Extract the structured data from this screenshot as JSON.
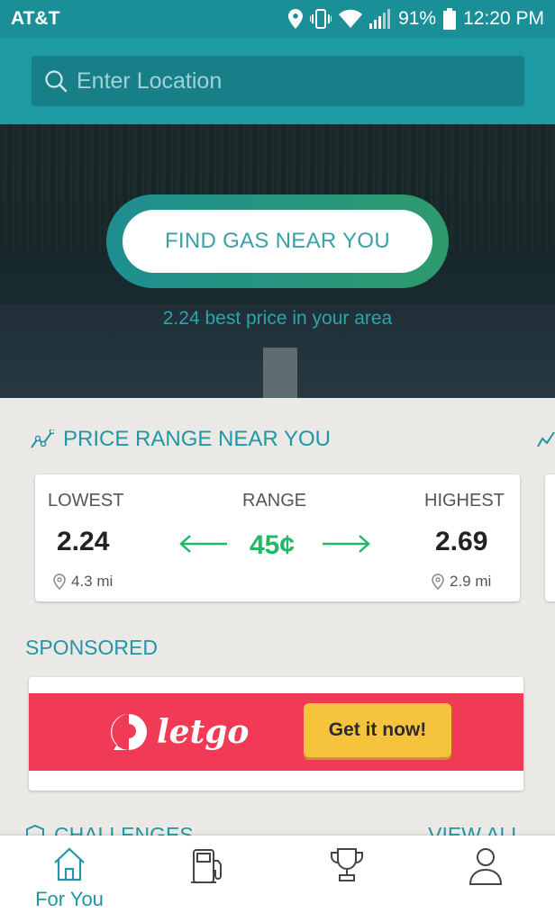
{
  "status_bar": {
    "carrier": "AT&T",
    "battery": "91%",
    "time": "12:20 PM"
  },
  "search": {
    "placeholder": "Enter Location"
  },
  "hero": {
    "cta_label": "FIND GAS NEAR YOU",
    "best_price_text": "2.24 best price in your area"
  },
  "price_range": {
    "title": "PRICE RANGE NEAR YOU",
    "lowest": {
      "label": "LOWEST",
      "value": "2.24",
      "distance": "4.3 mi"
    },
    "range": {
      "label": "RANGE",
      "value": "45¢"
    },
    "highest": {
      "label": "HIGHEST",
      "value": "2.69",
      "distance": "2.9 mi"
    }
  },
  "sponsored": {
    "title": "SPONSORED",
    "ad": {
      "brand": "letgo",
      "cta": "Get it now!",
      "background_color": "#f03a56",
      "cta_color": "#f6c33d"
    }
  },
  "challenges": {
    "title": "CHALLENGES",
    "view_all": "VIEW ALL"
  },
  "bottom_nav": {
    "items": [
      {
        "icon": "home-icon",
        "label": "For You",
        "active": true
      },
      {
        "icon": "gas-pump-icon",
        "label": "",
        "active": false
      },
      {
        "icon": "trophy-icon",
        "label": "",
        "active": false
      },
      {
        "icon": "profile-icon",
        "label": "",
        "active": false
      }
    ]
  },
  "colors": {
    "accent": "#2196a5",
    "header": "#1e9aa3",
    "range_green": "#22b86a"
  }
}
